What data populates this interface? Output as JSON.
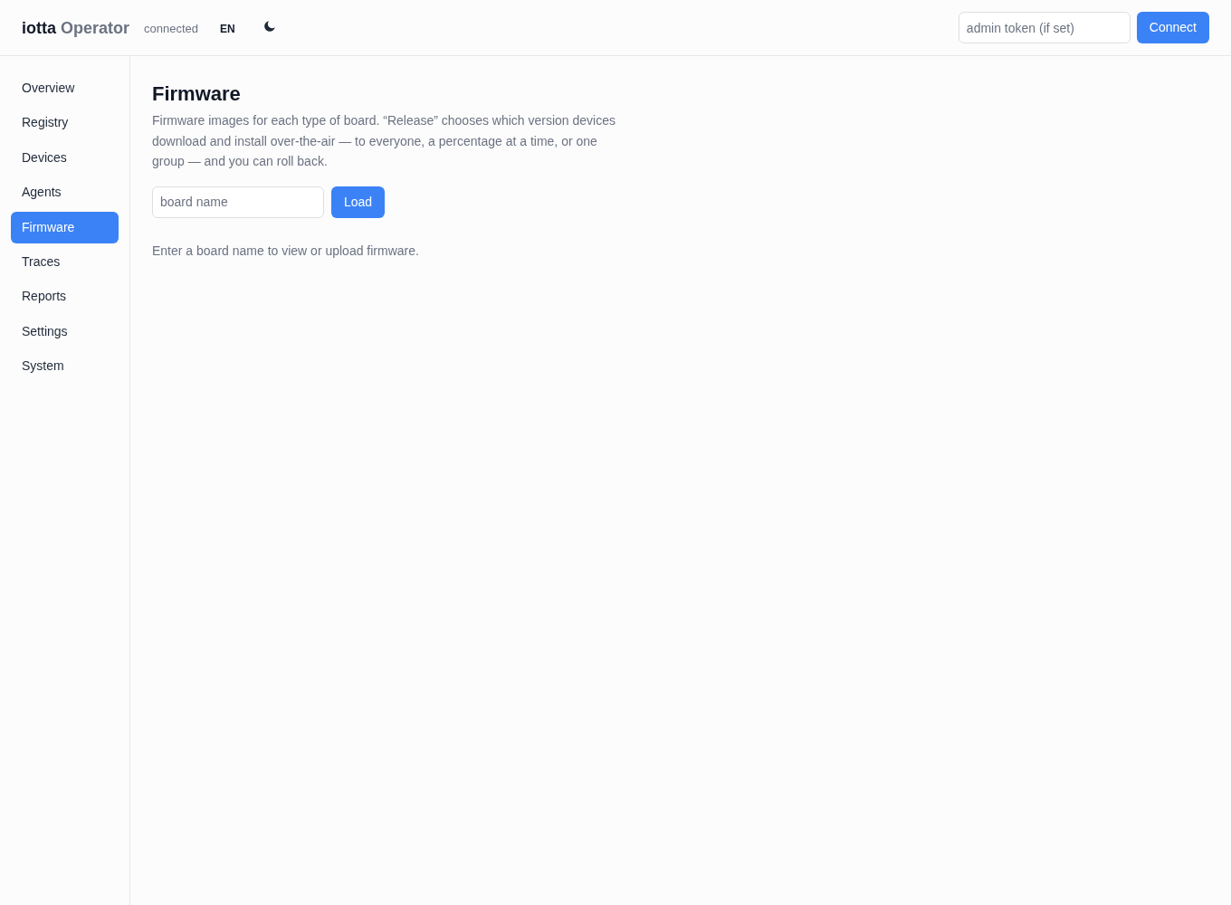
{
  "header": {
    "brand": {
      "name": "iotta",
      "product": "Operator"
    },
    "status": "connected",
    "language": "EN",
    "token_field": {
      "placeholder": "admin token (if set)"
    },
    "connect_button": "Connect"
  },
  "sidebar": {
    "items": [
      {
        "label": "Overview",
        "selected": false
      },
      {
        "label": "Registry",
        "selected": false
      },
      {
        "label": "Devices",
        "selected": false
      },
      {
        "label": "Agents",
        "selected": false
      },
      {
        "label": "Firmware",
        "selected": true
      },
      {
        "label": "Traces",
        "selected": false
      },
      {
        "label": "Reports",
        "selected": false
      },
      {
        "label": "Settings",
        "selected": false
      },
      {
        "label": "System",
        "selected": false
      }
    ]
  },
  "main": {
    "title": "Firmware",
    "description": "Firmware images for each type of board. “Release” chooses which version devices download and install over-the-air — to everyone, a percentage at a time, or one group — and you can roll back.",
    "board_field": {
      "placeholder": "board name"
    },
    "load_button": "Load",
    "hint": "Enter a board name to view or upload firmware."
  }
}
